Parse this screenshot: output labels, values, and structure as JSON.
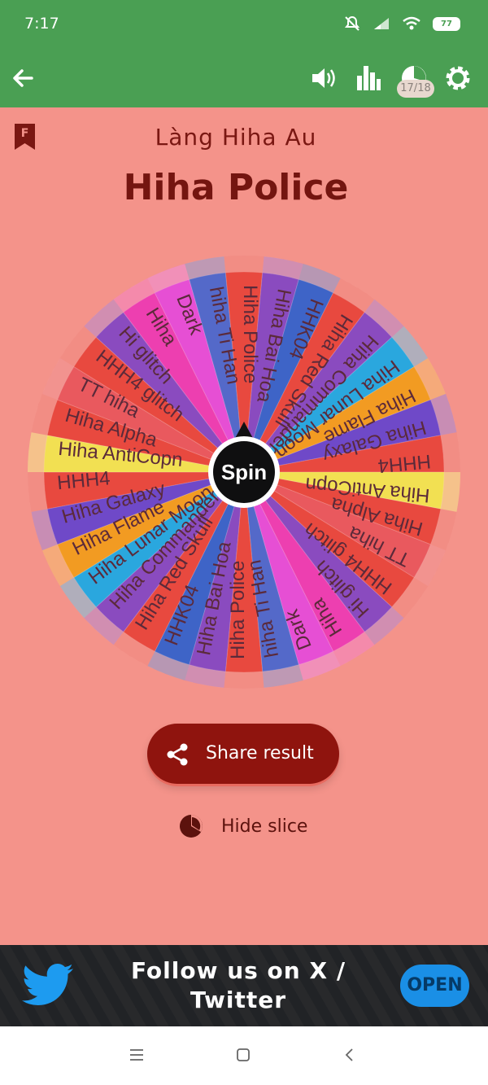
{
  "status_bar": {
    "time": "7:17",
    "battery": "77"
  },
  "app_bar": {
    "progress_badge": "17/18",
    "icons": [
      "back-arrow-icon",
      "volume-icon",
      "stats-icon",
      "pie-slice-icon",
      "settings-icon"
    ]
  },
  "header": {
    "subtitle": "Làng Hiha Au",
    "title": "Hiha Police"
  },
  "wheel": {
    "center_label": "Spin",
    "slices": [
      "Hiha Police",
      "Hiha Bai Hoa",
      "HHK04",
      "Hiha Red Skull",
      "Hiha Commander",
      "Hiha Lunar Moon",
      "Hiha Flame",
      "Hiha Galaxy",
      "HHH4",
      "Hiha AntiCopn",
      "Hiha Alpha",
      "TT hiha",
      "HHH4 glitch",
      "Hi glitch",
      "Hiha",
      "Dark",
      "hiha Ti Han"
    ],
    "colors": [
      "#e8493f",
      "#8a4bbf",
      "#3e64c7",
      "#e8493f",
      "#8a4bbf",
      "#2aa7de",
      "#f29b22",
      "#6f49c8",
      "#e8493f",
      "#f2e052",
      "#e8493f",
      "#e9595e",
      "#e8493f",
      "#8a4bbf",
      "#ed3fb0",
      "#e64fd4",
      "#5469c9"
    ]
  },
  "actions": {
    "share_label": "Share result",
    "hide_label": "Hide slice"
  },
  "banner": {
    "text": "Follow us on X / Twitter",
    "open_label": "OPEN"
  },
  "colors": {
    "background": "#f4938a",
    "appbar": "#4a9f53",
    "accent": "#8f140e",
    "open": "#1a8fe6"
  }
}
